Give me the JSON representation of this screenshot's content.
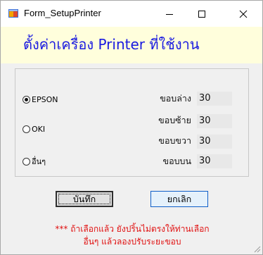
{
  "window": {
    "title": "Form_SetupPrinter",
    "minimize_glyph": "—",
    "maximize_glyph": "☐",
    "close_glyph": "✕"
  },
  "heading": "ตั้งค่าเครื่อง Printer ที่ใช้งาน",
  "printers": [
    {
      "label": "EPSON",
      "selected": true
    },
    {
      "label": "OKI",
      "selected": false
    },
    {
      "label": "อื่นๆ",
      "selected": false
    }
  ],
  "margins": {
    "bottom": {
      "label": "ขอบล่าง",
      "value": "30"
    },
    "left": {
      "label": "ขอบซ้าย",
      "value": "30"
    },
    "right": {
      "label": "ขอบขวา",
      "value": "30"
    },
    "top": {
      "label": "ขอบบน",
      "value": "30"
    }
  },
  "buttons": {
    "save": "บันทึก",
    "cancel": "ยกเลิก"
  },
  "note": {
    "line1": "*** ถ้าเลือกแล้ว  ยังปริ้นไม่ตรงให้ท่านเลือก",
    "line2": "อื่นๆ แล้วลองปรับระยะขอบ"
  },
  "colors": {
    "heading_bg": "#fffedc",
    "heading_text": "#1a1ae0",
    "note_text": "#e01010",
    "cancel_border": "#0f5ec9"
  },
  "icons": {
    "app": "form-app-icon",
    "minimize": "minimize-icon",
    "maximize": "maximize-icon",
    "close": "close-icon",
    "resize": "resize-grip-icon"
  }
}
